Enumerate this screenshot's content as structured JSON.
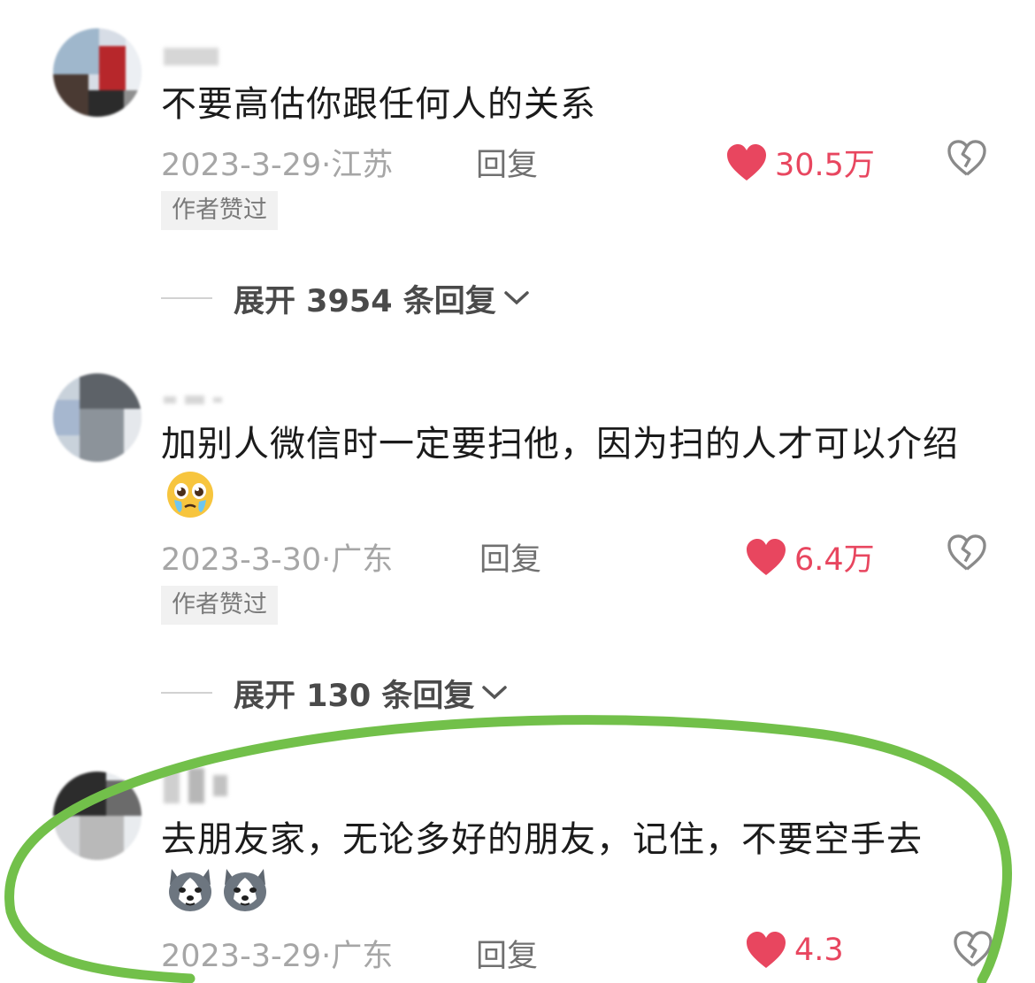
{
  "comments": [
    {
      "text": "不要高估你跟任何人的关系",
      "date": "2023-3-29",
      "location": "江苏",
      "reply_label": "回复",
      "likes": "30.5万",
      "badge": "作者赞过",
      "expand_label": "展开 3954 条回复"
    },
    {
      "text": "加别人微信时一定要扫他，因为扫的人才可以介绍",
      "emoji_icon": "pleading-face-icon",
      "date": "2023-3-30",
      "location": "广东",
      "reply_label": "回复",
      "likes": "6.4万",
      "badge": "作者赞过",
      "expand_label": "展开 130 条回复"
    },
    {
      "text": "去朋友家，无论多好的朋友，记住，不要空手去",
      "emoji_icon": "husky-dog-icon",
      "date": "2023-3-29",
      "location": "广东",
      "reply_label": "回复",
      "likes": "4.3"
    }
  ],
  "meta_separator": "·",
  "colors": {
    "like_red": "#e8465f",
    "highlight_green": "#72c04a",
    "meta_gray": "#a6a6a6"
  }
}
